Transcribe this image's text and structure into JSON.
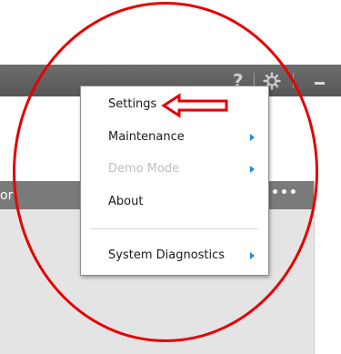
{
  "titlebar": {
    "help_label": "?"
  },
  "panel": {
    "title_partial": "or",
    "more_label": "•••"
  },
  "menu": {
    "items": [
      {
        "label": "Settings",
        "submenu": false,
        "disabled": false
      },
      {
        "label": "Maintenance",
        "submenu": true,
        "disabled": false
      },
      {
        "label": "Demo Mode",
        "submenu": true,
        "disabled": true
      },
      {
        "label": "About",
        "submenu": false,
        "disabled": false
      },
      {
        "label": "System Diagnostics",
        "submenu": true,
        "disabled": false
      }
    ]
  },
  "colors": {
    "annotation": "#e60000",
    "submenu_arrow": "#2f86d0",
    "titlebar": "#5f5f5f",
    "panel_header": "#7a7a7a"
  }
}
